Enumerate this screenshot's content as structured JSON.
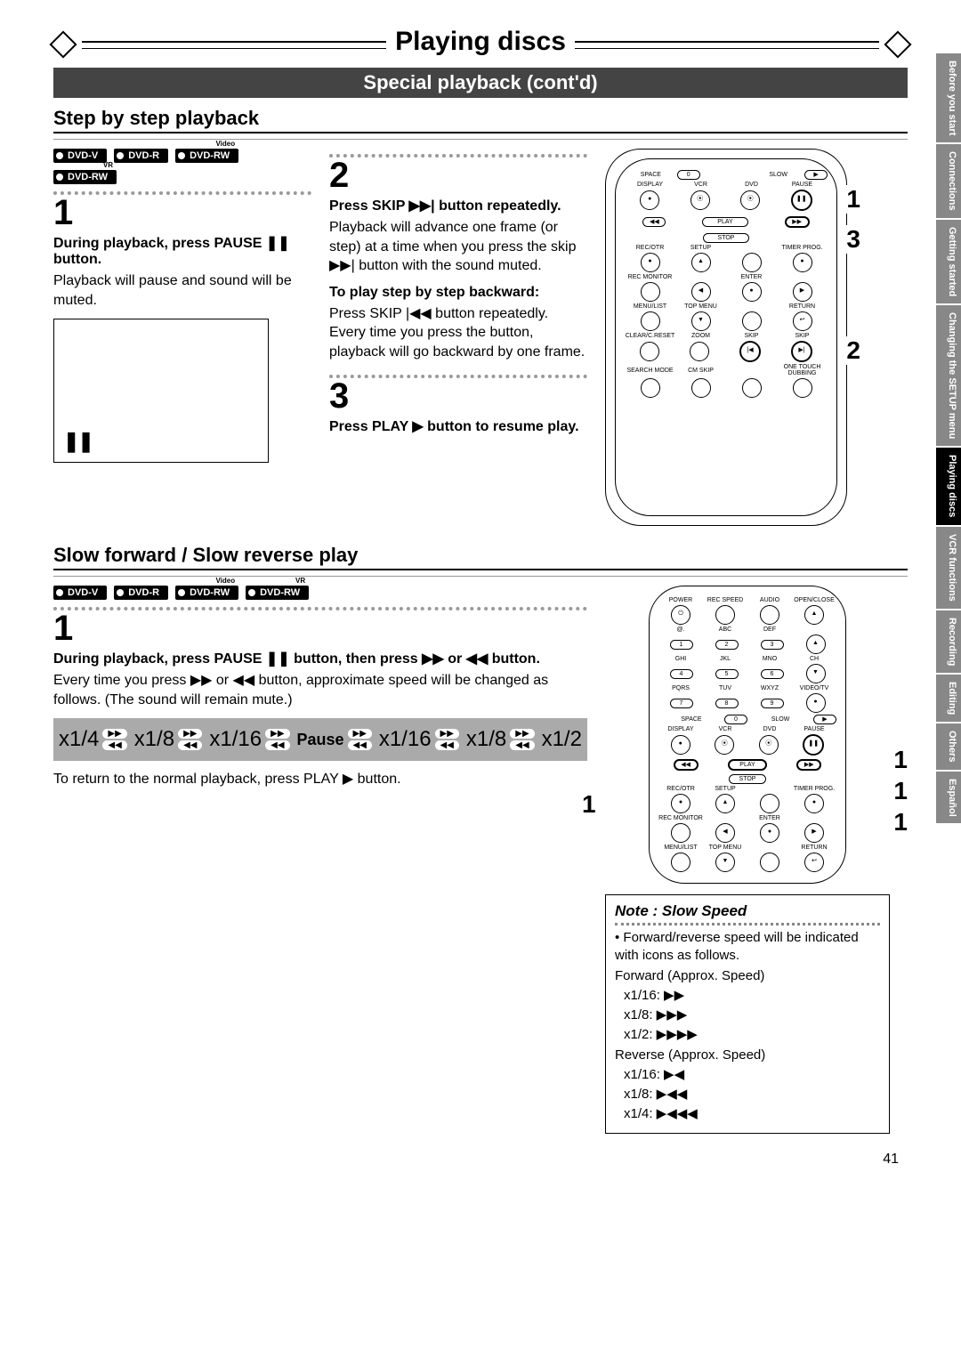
{
  "page_number": "41",
  "chapter_title": "Playing discs",
  "section_title": "Special playback (cont'd)",
  "side_tabs": [
    {
      "label": "Before you start",
      "active": false
    },
    {
      "label": "Connections",
      "active": false
    },
    {
      "label": "Getting started",
      "active": false
    },
    {
      "label": "Changing the SETUP menu",
      "active": false
    },
    {
      "label": "Playing discs",
      "active": true
    },
    {
      "label": "VCR functions",
      "active": false
    },
    {
      "label": "Recording",
      "active": false
    },
    {
      "label": "Editing",
      "active": false
    },
    {
      "label": "Others",
      "active": false
    },
    {
      "label": "Español",
      "active": false
    }
  ],
  "step_section": {
    "heading": "Step by step playback",
    "badges_row1": [
      "DVD-V",
      "DVD-R",
      "DVD-RW"
    ],
    "badge_row1_sup": [
      "",
      "",
      "Video"
    ],
    "badges_row2": [
      "DVD-RW"
    ],
    "badge_row2_sup": [
      "VR"
    ],
    "step1_num": "1",
    "step1_head": "During playback, press PAUSE ❚❚ button.",
    "step1_body": "Playback will pause and sound will be muted.",
    "step2_num": "2",
    "step2_head": "Press SKIP ▶▶| button repeatedly.",
    "step2_body": "Playback will advance one frame (or step) at a time when you press the skip ▶▶| button with the sound muted.",
    "step2_sub_head": "To play step by step backward:",
    "step2_sub_body": "Press SKIP |◀◀ button repeatedly. Every time you press the button, playback will go backward by one frame.",
    "step3_num": "3",
    "step3_head": "Press PLAY ▶ button to resume play."
  },
  "remote1": {
    "callout_top": "1",
    "callout_mid": "3",
    "callout_bot": "2",
    "rows": {
      "r1": [
        "SPACE",
        "",
        "SLOW"
      ],
      "r2": [
        "DISPLAY",
        "VCR",
        "DVD",
        "PAUSE"
      ],
      "r3": [
        "PLAY"
      ],
      "r4": [
        "STOP"
      ],
      "r5": [
        "REC/OTR",
        "SETUP",
        "",
        "TIMER PROG."
      ],
      "r6": [
        "REC MONITOR",
        "",
        "ENTER",
        ""
      ],
      "r7": [
        "MENU/LIST",
        "TOP MENU",
        "",
        "RETURN"
      ],
      "r8": [
        "CLEAR/C.RESET",
        "ZOOM",
        "SKIP",
        "SKIP"
      ],
      "r9": [
        "SEARCH MODE",
        "CM SKIP",
        "",
        "ONE TOUCH DUBBING"
      ]
    }
  },
  "slow_section": {
    "heading": "Slow forward / Slow reverse play",
    "badges": [
      "DVD-V",
      "DVD-R",
      "DVD-RW",
      "DVD-RW"
    ],
    "badge_sup": [
      "",
      "",
      "Video",
      "VR"
    ],
    "step1_num": "1",
    "step1_head": "During playback, press PAUSE ❚❚ button, then press ▶▶ or ◀◀ button.",
    "step1_body": "Every time you press ▶▶ or ◀◀ button, approximate speed will be changed as follows. (The sound will remain mute.)",
    "speeds_rev": [
      "x1/4",
      "x1/8",
      "x1/16"
    ],
    "pause_label": "Pause",
    "speeds_fwd": [
      "x1/16",
      "x1/8",
      "x1/2"
    ],
    "resume_text": "To return to the normal playback, press PLAY ▶ button."
  },
  "remote2": {
    "callout_left": "1",
    "callout_r1": "1",
    "callout_r2": "1",
    "callout_r3": "1",
    "rows": {
      "r0": [
        "POWER",
        "REC SPEED",
        "AUDIO",
        "OPEN/CLOSE"
      ],
      "r1": [
        "@.",
        "ABC",
        "DEF",
        ""
      ],
      "n1": [
        "1",
        "2",
        "3",
        "▲"
      ],
      "r2": [
        "GHI",
        "JKL",
        "MNO",
        "CH"
      ],
      "n2": [
        "4",
        "5",
        "6",
        "▼"
      ],
      "r3": [
        "PQRS",
        "TUV",
        "WXYZ",
        "VIDEO/TV"
      ],
      "n3": [
        "7",
        "8",
        "9",
        "●"
      ],
      "r4": [
        "SPACE",
        "",
        "SLOW"
      ],
      "n4": [
        "0"
      ],
      "r5": [
        "DISPLAY",
        "VCR",
        "DVD",
        "PAUSE"
      ],
      "r6": [
        "PLAY"
      ],
      "r7": [
        "STOP"
      ],
      "r8": [
        "REC/OTR",
        "SETUP",
        "",
        "TIMER PROG."
      ],
      "r9": [
        "REC MONITOR",
        "",
        "ENTER",
        ""
      ],
      "r10": [
        "MENU/LIST",
        "TOP MENU",
        "",
        "RETURN"
      ]
    }
  },
  "note": {
    "title": "Note : Slow Speed",
    "bullet": "• Forward/reverse speed will be indicated with icons as follows.",
    "fwd_label": "Forward (Approx. Speed)",
    "fwd_lines": [
      "x1/16: ▶▶",
      "x1/8:  ▶▶▶",
      "x1/2:  ▶▶▶▶"
    ],
    "rev_label": "Reverse (Approx. Speed)",
    "rev_lines": [
      "x1/16: ▶◀",
      "x1/8:  ▶◀◀",
      "x1/4:  ▶◀◀◀"
    ]
  }
}
